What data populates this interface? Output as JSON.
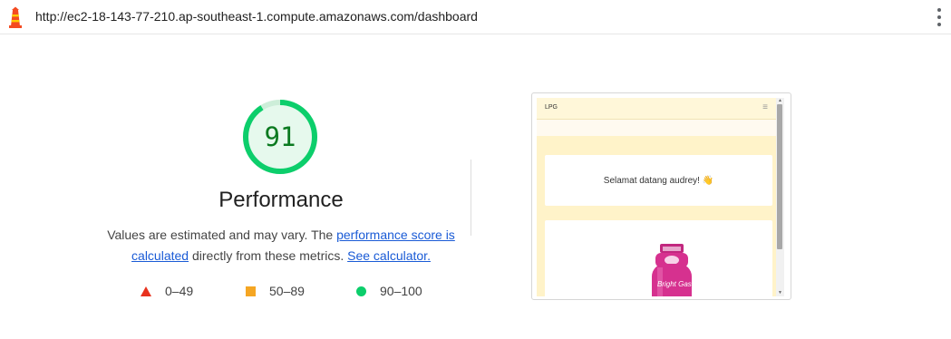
{
  "browser": {
    "url": "http://ec2-18-143-77-210.ap-southeast-1.compute.amazonaws.com/dashboard",
    "app_icon": "lighthouse-icon",
    "menu_icon": "kebab-menu-icon"
  },
  "performance": {
    "score": "91",
    "score_fraction": 0.91,
    "title": "Performance",
    "desc_prefix": "Values are estimated and may vary. The ",
    "link_score": "performance score is calculated",
    "desc_middle": " directly from these metrics. ",
    "link_calculator": "See calculator.",
    "colors": {
      "pass": "#0cce6b",
      "pass_text": "#0b7a20",
      "average": "#f5a623",
      "fail": "#e8321e"
    }
  },
  "legend": [
    {
      "icon": "triangle-icon",
      "label": "0–49"
    },
    {
      "icon": "square-icon",
      "label": "50–89"
    },
    {
      "icon": "circle-icon",
      "label": "90–100"
    }
  ],
  "preview": {
    "brand": "LPG",
    "menu_icon": "hamburger-icon",
    "greeting": "Selamat datang audrey! 👋",
    "product_label": "Bright Gas",
    "colors": {
      "background": "#fff3c9",
      "cylinder": "#d6318f"
    }
  }
}
